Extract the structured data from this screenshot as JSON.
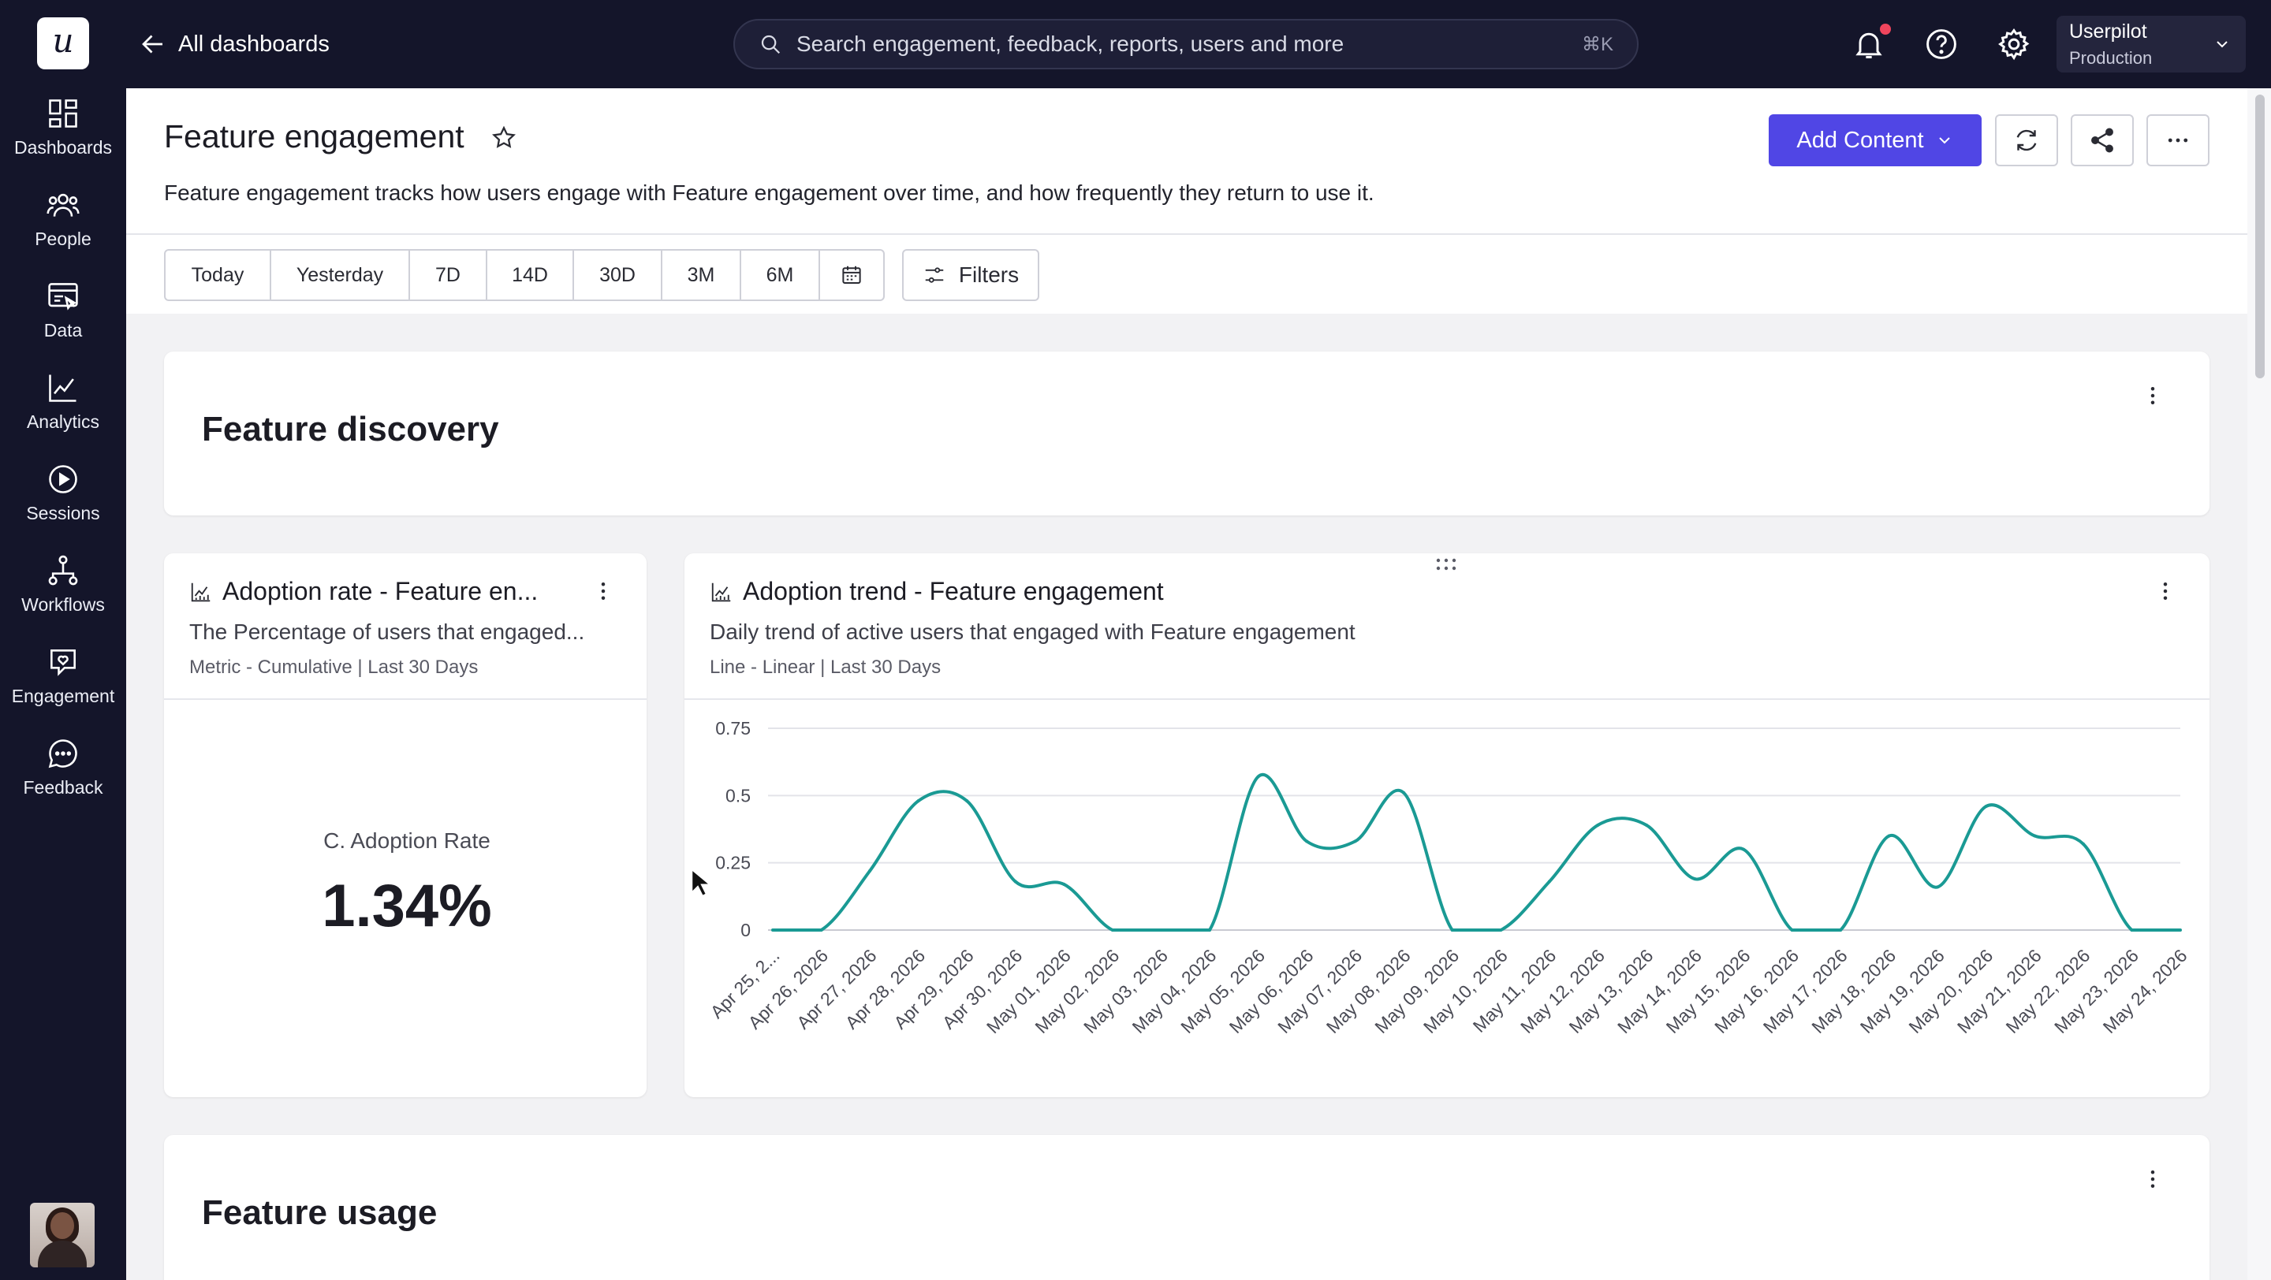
{
  "nav": {
    "logo_letter": "u",
    "items": [
      {
        "label": "Dashboards",
        "icon": "dashboards-icon"
      },
      {
        "label": "People",
        "icon": "people-icon"
      },
      {
        "label": "Data",
        "icon": "data-icon"
      },
      {
        "label": "Analytics",
        "icon": "analytics-icon"
      },
      {
        "label": "Sessions",
        "icon": "sessions-icon"
      },
      {
        "label": "Workflows",
        "icon": "workflows-icon"
      },
      {
        "label": "Engagement",
        "icon": "engagement-icon"
      },
      {
        "label": "Feedback",
        "icon": "feedback-icon"
      }
    ]
  },
  "topbar": {
    "back_label": "All dashboards",
    "search_placeholder": "Search engagement, feedback, reports, users and more",
    "search_shortcut": "⌘K",
    "account_name": "Userpilot",
    "account_env": "Production"
  },
  "header": {
    "title": "Feature engagement",
    "description": "Feature engagement tracks how users engage with Feature engagement over time, and how frequently they return to use it.",
    "add_content_label": "Add Content",
    "ranges": [
      "Today",
      "Yesterday",
      "7D",
      "14D",
      "30D",
      "3M",
      "6M"
    ],
    "filters_label": "Filters"
  },
  "sections": {
    "discovery_title": "Feature discovery",
    "usage_title": "Feature usage"
  },
  "adoption_rate_card": {
    "title": "Adoption rate - Feature en...",
    "subtitle": "The Percentage of users that engaged...",
    "meta": "Metric - Cumulative | Last 30 Days",
    "metric_label": "C. Adoption Rate",
    "metric_value": "1.34%"
  },
  "adoption_trend_card": {
    "title": "Adoption trend - Feature engagement",
    "subtitle": "Daily trend of active users that engaged with Feature engagement",
    "meta": "Line - Linear | Last 30 Days"
  },
  "colors": {
    "nav_bg": "#14152a",
    "accent": "#5046e5",
    "line": "#1a9a94",
    "notification": "#f0455d"
  },
  "chart_data": {
    "type": "line",
    "title": "",
    "xlabel": "",
    "ylabel": "",
    "ylim": [
      0,
      0.75
    ],
    "yticks": [
      0,
      0.25,
      0.5,
      0.75
    ],
    "grid": true,
    "x": [
      "Apr 25, 2...",
      "Apr 26, 2026",
      "Apr 27, 2026",
      "Apr 28, 2026",
      "Apr 29, 2026",
      "Apr 30, 2026",
      "May 01, 2026",
      "May 02, 2026",
      "May 03, 2026",
      "May 04, 2026",
      "May 05, 2026",
      "May 06, 2026",
      "May 07, 2026",
      "May 08, 2026",
      "May 09, 2026",
      "May 10, 2026",
      "May 11, 2026",
      "May 12, 2026",
      "May 13, 2026",
      "May 14, 2026",
      "May 15, 2026",
      "May 16, 2026",
      "May 17, 2026",
      "May 18, 2026",
      "May 19, 2026",
      "May 20, 2026",
      "May 21, 2026",
      "May 22, 2026",
      "May 23, 2026",
      "May 24, 2026"
    ],
    "series": [
      {
        "values": [
          0,
          0,
          0.22,
          0.48,
          0.48,
          0.18,
          0.17,
          0,
          0,
          0,
          0.57,
          0.33,
          0.33,
          0.51,
          0,
          0,
          0.18,
          0.39,
          0.39,
          0.19,
          0.3,
          0,
          0,
          0.35,
          0.16,
          0.46,
          0.35,
          0.32,
          0,
          0
        ]
      }
    ]
  }
}
